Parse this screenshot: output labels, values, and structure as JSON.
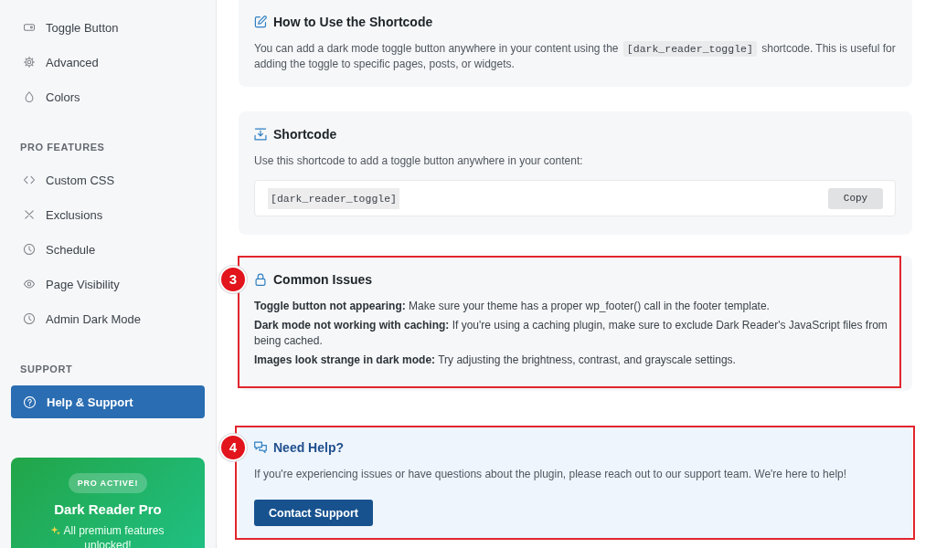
{
  "sidebar": {
    "sections": [
      {
        "items": [
          {
            "label": "Toggle Button",
            "selected": false
          },
          {
            "label": "Advanced",
            "selected": false
          },
          {
            "label": "Colors",
            "selected": false
          }
        ]
      },
      {
        "heading": "PRO FEATURES",
        "items": [
          {
            "label": "Custom CSS",
            "selected": false
          },
          {
            "label": "Exclusions",
            "selected": false
          },
          {
            "label": "Schedule",
            "selected": false
          },
          {
            "label": "Page Visibility",
            "selected": false
          },
          {
            "label": "Admin Dark Mode",
            "selected": false
          }
        ]
      },
      {
        "heading": "SUPPORT",
        "items": [
          {
            "label": "Help & Support",
            "selected": true
          }
        ]
      }
    ],
    "pro_card": {
      "badge": "PRO ACTIVE!",
      "title": "Dark Reader Pro",
      "text": "All premium features unlocked!"
    }
  },
  "cards": [
    {
      "kind": "usage",
      "title": "How to Use the Shortcode",
      "body": [
        {
          "kind": "text",
          "text": "You can add a dark mode toggle button anywhere in your content using the "
        },
        {
          "kind": "code",
          "text": "[dark_reader_toggle]"
        },
        {
          "kind": "text",
          "text": " shortcode. This is useful for adding the toggle to specific pages, posts, or widgets."
        }
      ]
    },
    {
      "kind": "shortcode",
      "title": "Shortcode",
      "description": "Use this shortcode to add a toggle button anywhere in your content:",
      "shortcode": "[dark_reader_toggle]",
      "copy_button": "Copy"
    },
    {
      "kind": "issues",
      "callout": "3",
      "title": "Common Issues",
      "issues": [
        "**Toggle button not appearing:** Make sure your theme has a proper wp_footer() call in the footer template.",
        "**Dark mode not working with caching:** If you're using a caching plugin, make sure to exclude Dark Reader's JavaScript files from being cached.",
        "**Images look strange in dark mode:** Try adjusting the brightness, contrast, and grayscale settings."
      ]
    },
    {
      "kind": "help",
      "callout": "4",
      "title": "Need Help?",
      "text": "If you're experiencing issues or have questions about the plugin, please reach out to our support team. We're here to help!",
      "button": "Contact Support"
    }
  ]
}
